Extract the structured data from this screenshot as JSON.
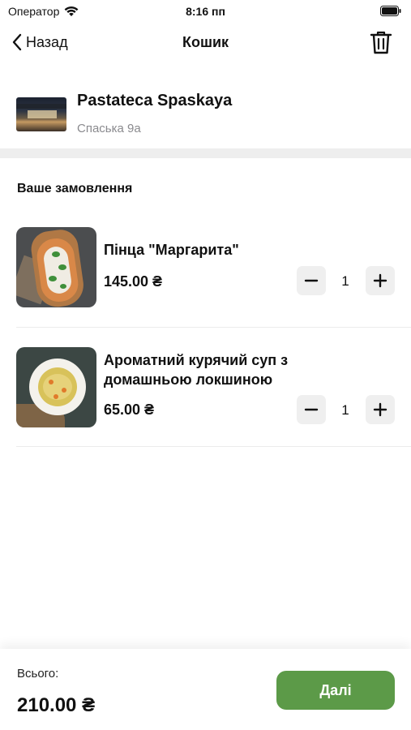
{
  "status_bar": {
    "carrier": "Оператор",
    "time": "8:16 пп"
  },
  "nav": {
    "back_label": "Назад",
    "title": "Кошик"
  },
  "restaurant": {
    "name": "Pastateca Spaskaya",
    "address": "Спаська 9а"
  },
  "order": {
    "section_title": "Ваше замовлення",
    "items": [
      {
        "name": "Пінца \"Маргарита\"",
        "price": "145.00 ₴",
        "quantity": "1"
      },
      {
        "name": "Ароматний курячий суп з домашньою локшиною",
        "price": "65.00 ₴",
        "quantity": "1"
      }
    ]
  },
  "footer": {
    "total_label": "Всього:",
    "total_value": "210.00 ₴",
    "next_label": "Далі"
  },
  "colors": {
    "accent_green": "#5c9a48",
    "qty_button_bg": "#efefef",
    "muted_text": "#8a8a8e"
  }
}
